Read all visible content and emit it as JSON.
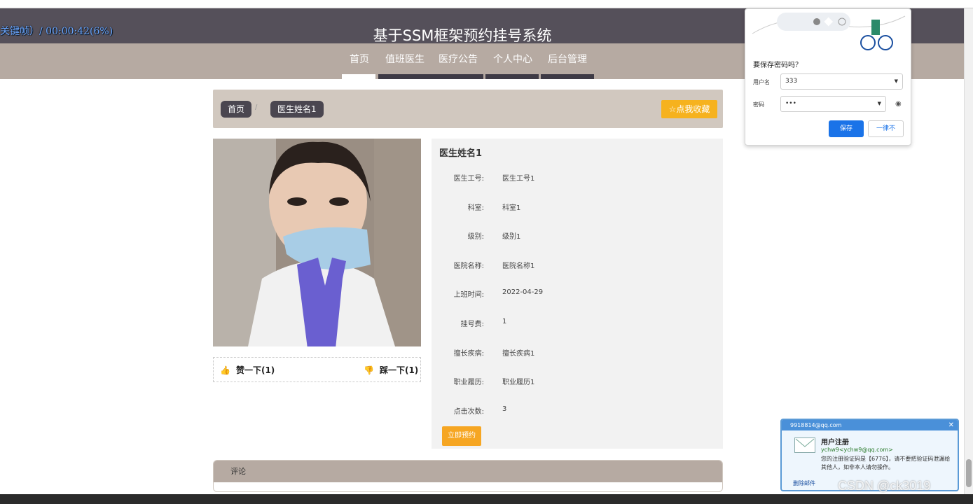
{
  "overlay": {
    "timer": "关键帧）/ 00:00:42(6%)"
  },
  "header": {
    "title": "基于SSM框架预约挂号系统"
  },
  "nav": {
    "items": [
      "首页",
      "值班医生",
      "医疗公告",
      "个人中心",
      "后台管理"
    ],
    "active": 0
  },
  "breadcrumb": {
    "home": "首页",
    "sep": "/",
    "current": "医生姓名1",
    "favorite": "☆点我收藏"
  },
  "votes": {
    "like": "赞一下(1)",
    "dislike": "踩一下(1)"
  },
  "doctor": {
    "name": "医生姓名1",
    "fields": [
      {
        "label": "医生工号:",
        "value": "医生工号1"
      },
      {
        "label": "科室:",
        "value": "科室1"
      },
      {
        "label": "级别:",
        "value": "级别1"
      },
      {
        "label": "医院名称:",
        "value": "医院名称1"
      },
      {
        "label": "上班时间:",
        "value": "2022-04-29"
      },
      {
        "label": "挂号费:",
        "value": "1"
      },
      {
        "label": "擅长疾病:",
        "value": "擅长疾病1"
      },
      {
        "label": "职业履历:",
        "value": "职业履历1"
      },
      {
        "label": "点击次数:",
        "value": "3"
      }
    ],
    "book_label": "立即预约"
  },
  "comments": {
    "title": "评论"
  },
  "password_popup": {
    "title": "要保存密码吗？",
    "username_label": "用户名",
    "username_value": "333",
    "password_label": "密码",
    "password_value": "•••",
    "save_label": "保存",
    "never_label": "一律不"
  },
  "mail_popup": {
    "account": "9918814@qq.com",
    "subject": "用户注册",
    "from": "ychw9<ychw9@qq.com>",
    "body": "您的注册验证码是【6776】，请不要把验证码泄漏给其他人，如非本人请勿操作。",
    "delete_label": "删除邮件"
  },
  "watermark": "CSDN @ck3019",
  "colors": {
    "header": "#55505a",
    "nav": "#b6aaa2",
    "accent": "#f6b21e",
    "info_bg": "#f2f2f2"
  }
}
